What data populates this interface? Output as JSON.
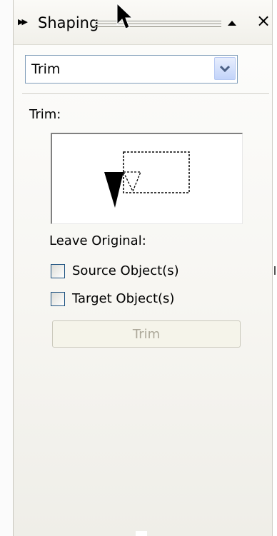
{
  "titlebar": {
    "title": "Shaping",
    "expand_icon": "double-chevron-right-icon",
    "collapse_icon": "triangle-up-icon",
    "close_label": "×"
  },
  "operation_select": {
    "value": "Trim"
  },
  "section": {
    "label": "Trim:"
  },
  "leave_original": {
    "label": "Leave Original:",
    "source": {
      "label": "Source Object(s)",
      "checked": false
    },
    "target": {
      "label": "Target Object(s)",
      "checked": false
    }
  },
  "apply_button": {
    "label": "Trim",
    "enabled": false
  },
  "colors": {
    "select_border": "#7f9db9",
    "select_button": "#c2d3fa",
    "checkbox_border": "#1c5180",
    "disabled_text": "#aca899"
  }
}
